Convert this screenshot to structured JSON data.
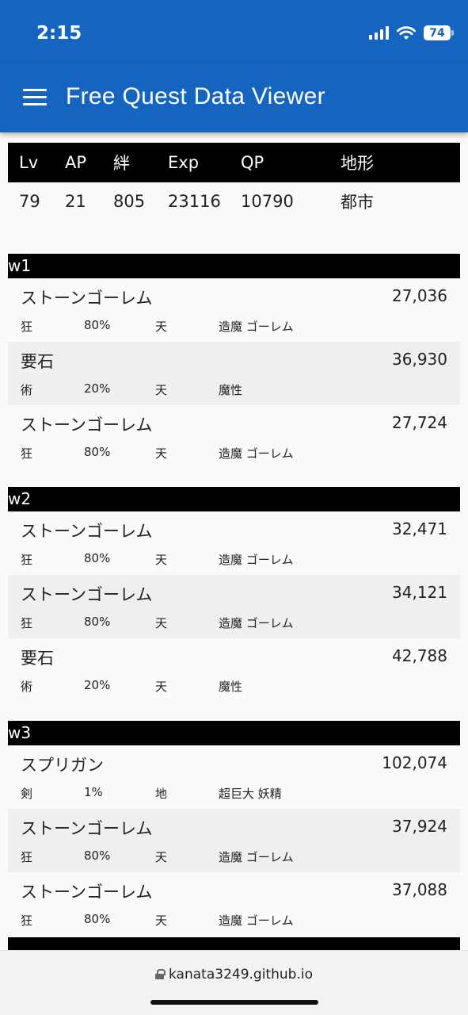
{
  "status_bar": {
    "time": "2:15",
    "battery": "74"
  },
  "app_bar": {
    "title": "Free Quest Data Viewer"
  },
  "quest_info": {
    "headers": [
      "Lv",
      "AP",
      "絆",
      "Exp",
      "QP",
      "地形"
    ],
    "values": [
      "79",
      "21",
      "805",
      "23116",
      "10790",
      "都市"
    ]
  },
  "waves": [
    {
      "label": "w1",
      "enemies": [
        {
          "name": "ストーンゴーレム",
          "hp": "27,036",
          "class": "狂",
          "rate": "80%",
          "attribute": "天",
          "traits": "造魔 ゴーレム"
        },
        {
          "name": "要石",
          "hp": "36,930",
          "class": "術",
          "rate": "20%",
          "attribute": "天",
          "traits": "魔性"
        },
        {
          "name": "ストーンゴーレム",
          "hp": "27,724",
          "class": "狂",
          "rate": "80%",
          "attribute": "天",
          "traits": "造魔 ゴーレム"
        }
      ]
    },
    {
      "label": "w2",
      "enemies": [
        {
          "name": "ストーンゴーレム",
          "hp": "32,471",
          "class": "狂",
          "rate": "80%",
          "attribute": "天",
          "traits": "造魔 ゴーレム"
        },
        {
          "name": "ストーンゴーレム",
          "hp": "34,121",
          "class": "狂",
          "rate": "80%",
          "attribute": "天",
          "traits": "造魔 ゴーレム"
        },
        {
          "name": "要石",
          "hp": "42,788",
          "class": "術",
          "rate": "20%",
          "attribute": "天",
          "traits": "魔性"
        }
      ]
    },
    {
      "label": "w3",
      "enemies": [
        {
          "name": "スプリガン",
          "hp": "102,074",
          "class": "剣",
          "rate": "1%",
          "attribute": "地",
          "traits": "超巨大 妖精"
        },
        {
          "name": "ストーンゴーレム",
          "hp": "37,924",
          "class": "狂",
          "rate": "80%",
          "attribute": "天",
          "traits": "造魔 ゴーレム"
        },
        {
          "name": "ストーンゴーレム",
          "hp": "37,088",
          "class": "狂",
          "rate": "80%",
          "attribute": "天",
          "traits": "造魔 ゴーレム"
        }
      ]
    }
  ],
  "browser": {
    "url": "kanata3249.github.io"
  },
  "colors": {
    "app_bar": "#1565c0",
    "header_bg": "#000000",
    "alt_row": "#efefef"
  }
}
